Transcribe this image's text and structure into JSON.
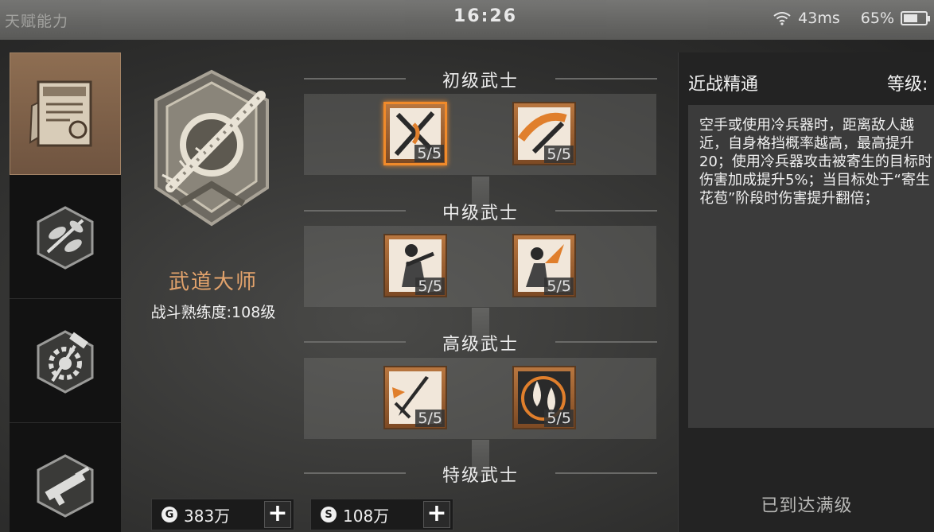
{
  "status_bar": {
    "page_title": "天赋能力",
    "clock": "16:26",
    "ping": "43ms",
    "battery": "65%",
    "battery_level": 0.65
  },
  "categories": [
    {
      "name": "trade-certificate-icon",
      "active": true
    },
    {
      "name": "herb-leaf-icon",
      "active": false
    },
    {
      "name": "gear-hammer-icon",
      "active": false
    },
    {
      "name": "rifle-icon",
      "active": false
    }
  ],
  "profile": {
    "emblem_icon": "spiked-bat-emblem-icon",
    "name": "武道大师",
    "level": "战斗熟练度:108级"
  },
  "currency": [
    {
      "icon": "gold-coin-icon",
      "symbol": "G",
      "amount": "383万"
    },
    {
      "icon": "silver-coin-icon",
      "symbol": "S",
      "amount": "108万"
    }
  ],
  "tiers": [
    {
      "label": "初级武士",
      "skills": [
        {
          "icon": "crossed-blades-icon",
          "rank": "5/5",
          "selected": true
        },
        {
          "icon": "blade-swing-icon",
          "rank": "5/5",
          "selected": false
        }
      ]
    },
    {
      "label": "中级武士",
      "skills": [
        {
          "icon": "martial-artist-icon",
          "rank": "5/5",
          "selected": false
        },
        {
          "icon": "fighter-strike-icon",
          "rank": "5/5",
          "selected": false
        }
      ]
    },
    {
      "label": "高级武士",
      "skills": [
        {
          "icon": "dagger-icon",
          "rank": "5/5",
          "selected": false
        },
        {
          "icon": "blood-drop-icon",
          "rank": "5/5",
          "selected": false
        }
      ]
    },
    {
      "label": "特级武士",
      "skills": []
    }
  ],
  "detail": {
    "title": "近战精通",
    "level_label": "等级:",
    "description": "空手或使用冷兵器时，距离敌人越近，自身格挡概率越高，最高提升20；使用冷兵器攻击被寄生的目标时伤害加成提升5%；当目标处于“寄生花苞”阶段时伤害提升翻倍；",
    "status": "已到达满级"
  },
  "colors": {
    "accent_orange": "#f08a2a",
    "profile_name": "#e3a36c",
    "active_category": "#8e6e52"
  }
}
